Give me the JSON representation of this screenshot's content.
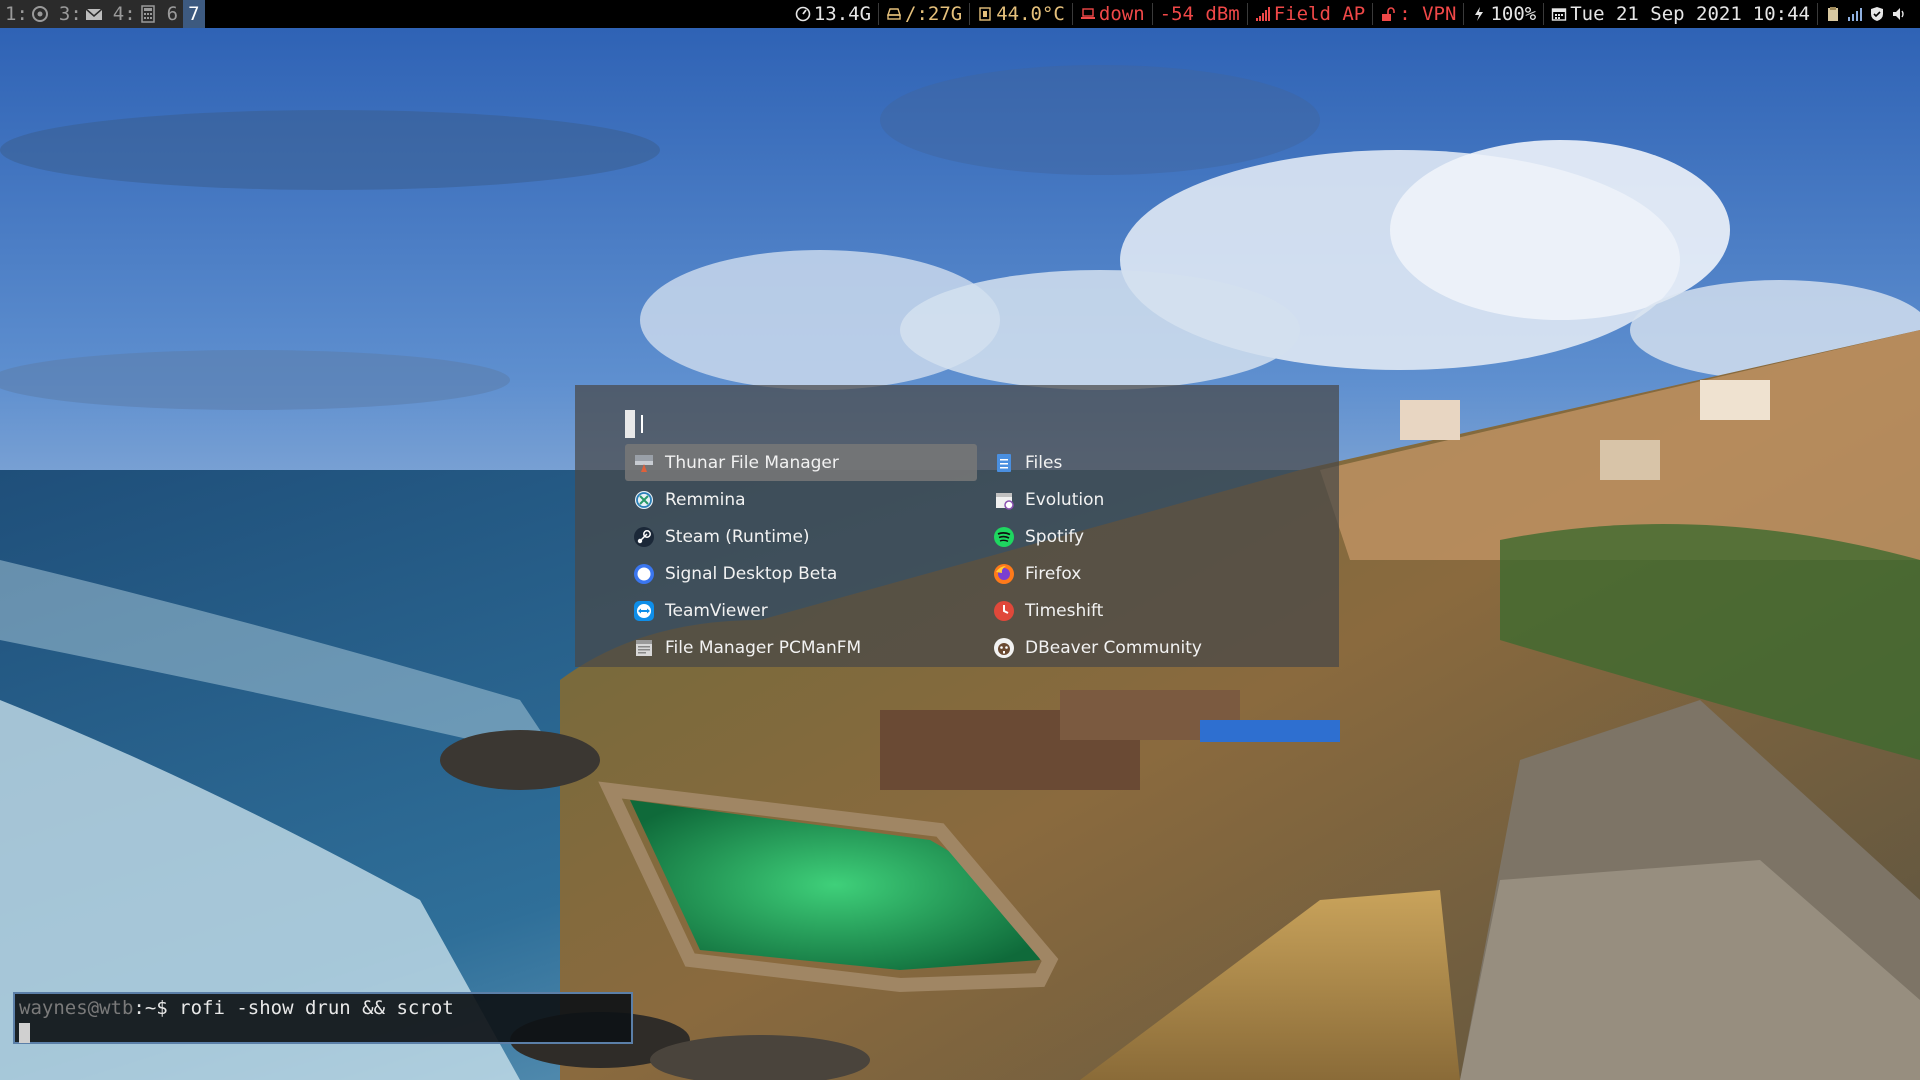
{
  "workspaces": [
    {
      "number": "1:",
      "icon": "chrome-icon",
      "focused": false
    },
    {
      "number": "3:",
      "icon": "mail-icon",
      "focused": false
    },
    {
      "number": "4:",
      "icon": "calculator-icon",
      "focused": false
    },
    {
      "number": "6",
      "icon": "",
      "focused": false
    },
    {
      "number": "7",
      "icon": "",
      "focused": true
    }
  ],
  "status": {
    "memory": "13.4G",
    "disk": "/:27G",
    "cpu_temp": "44.0°C",
    "ethernet": "down",
    "wifi_signal": "-54 dBm",
    "wifi_ssid": "Field AP",
    "vpn": ": VPN",
    "battery": "100%",
    "date": "Tue 21 Sep 2021",
    "time": "10:44"
  },
  "colors": {
    "focused_workspace": "#3d5a80",
    "status_green": "#9bd35a",
    "status_yellow": "#e5c07b",
    "status_red": "#f04848",
    "terminal_border": "#5b7fa8"
  },
  "rofi": {
    "input_value": "",
    "items": [
      {
        "label": "Thunar File Manager",
        "icon": "thunar-icon",
        "selected": true
      },
      {
        "label": "Files",
        "icon": "files-icon",
        "selected": false
      },
      {
        "label": "Remmina",
        "icon": "remmina-icon",
        "selected": false
      },
      {
        "label": "Evolution",
        "icon": "evolution-icon",
        "selected": false
      },
      {
        "label": "Steam (Runtime)",
        "icon": "steam-icon",
        "selected": false
      },
      {
        "label": "Spotify",
        "icon": "spotify-icon",
        "selected": false
      },
      {
        "label": "Signal Desktop Beta",
        "icon": "signal-icon",
        "selected": false
      },
      {
        "label": "Firefox",
        "icon": "firefox-icon",
        "selected": false
      },
      {
        "label": "TeamViewer",
        "icon": "teamviewer-icon",
        "selected": false
      },
      {
        "label": "Timeshift",
        "icon": "timeshift-icon",
        "selected": false
      },
      {
        "label": "File Manager PCManFM",
        "icon": "pcmanfm-icon",
        "selected": false
      },
      {
        "label": "DBeaver Community",
        "icon": "dbeaver-icon",
        "selected": false
      }
    ]
  },
  "terminal": {
    "user_host": "waynes@wtb",
    "prompt": ":~$ ",
    "command": "rofi -show drun && scrot"
  }
}
